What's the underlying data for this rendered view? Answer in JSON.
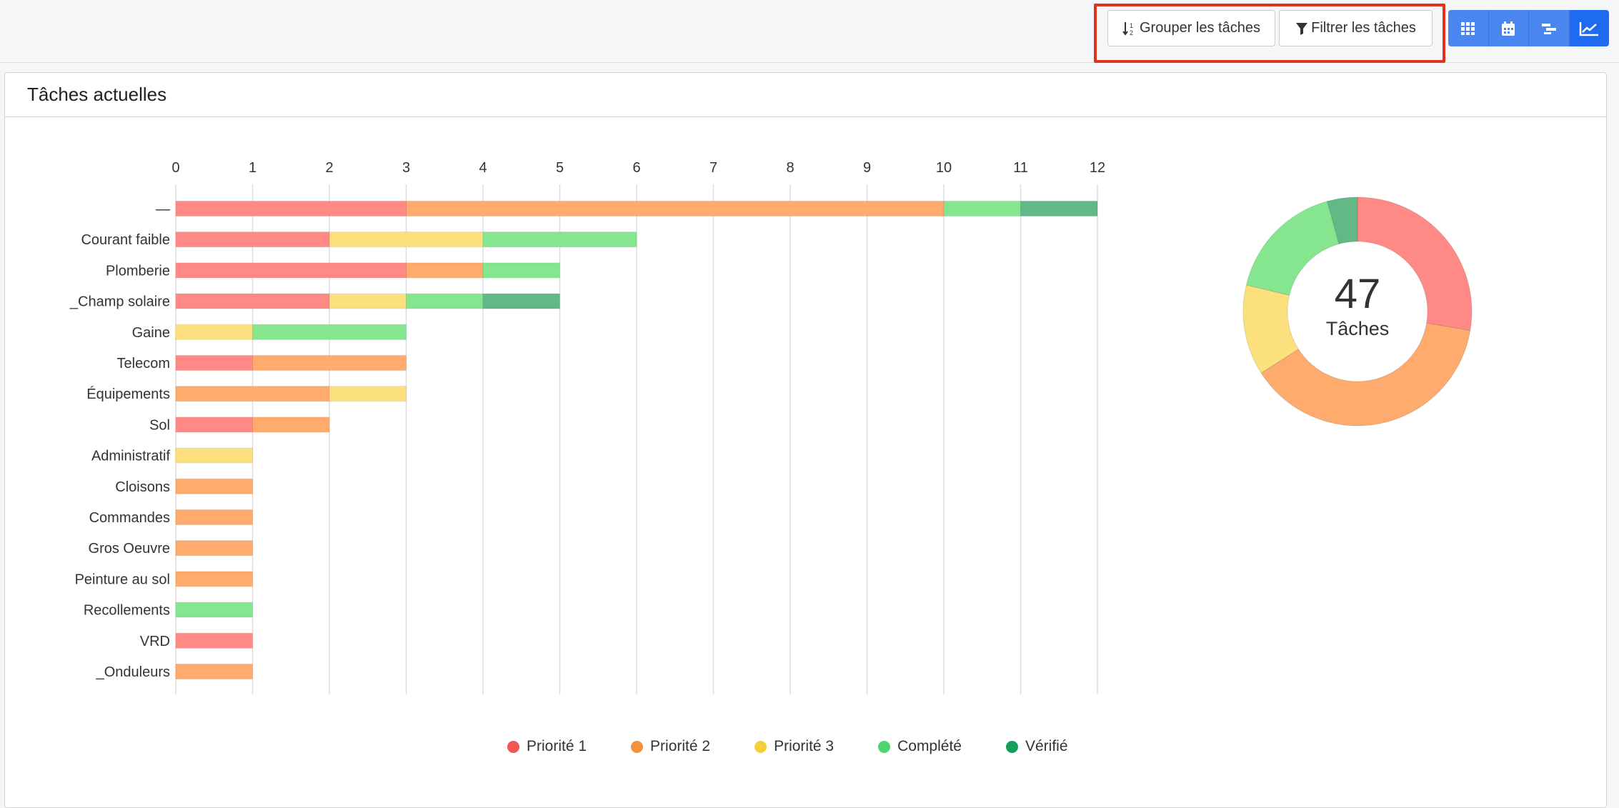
{
  "toolbar": {
    "group_label": "Grouper les tâches",
    "filter_label": "Filtrer les tâches",
    "views": [
      {
        "icon": "grid-icon",
        "active": false
      },
      {
        "icon": "calendar-icon",
        "active": false
      },
      {
        "icon": "gantt-icon",
        "active": false
      },
      {
        "icon": "chart-line-icon",
        "active": true
      }
    ]
  },
  "panel": {
    "title": "Tâches actuelles"
  },
  "colors": {
    "Priorité 1": "#ff8a85",
    "Priorité 2": "#ffab6e",
    "Priorité 3": "#fde07e",
    "Complété": "#86e690",
    "Vérifié": "#62b886"
  },
  "legend_dot_colors": {
    "Priorité 1": "#f25555",
    "Priorité 2": "#f5913c",
    "Priorité 3": "#f5cf3c",
    "Complété": "#4fd56a",
    "Vérifié": "#14a05a"
  },
  "chart_data": {
    "type": "bar",
    "orientation": "horizontal",
    "stacked": true,
    "xlim": [
      0,
      12
    ],
    "ticks": [
      0,
      1,
      2,
      3,
      4,
      5,
      6,
      7,
      8,
      9,
      10,
      11,
      12
    ],
    "grid": true,
    "legend_placement": "bottom",
    "categories": [
      "—",
      "Courant faible",
      "Plomberie",
      "_Champ solaire",
      "Gaine",
      "Telecom",
      "Équipements",
      "Sol",
      "Administratif",
      "Cloisons",
      "Commandes",
      "Gros Oeuvre",
      "Peinture au sol",
      "Recollements",
      "VRD",
      "_Onduleurs"
    ],
    "series": [
      {
        "name": "Priorité 1",
        "values": [
          3,
          2,
          3,
          2,
          0,
          1,
          0,
          1,
          0,
          0,
          0,
          0,
          0,
          0,
          1,
          0
        ]
      },
      {
        "name": "Priorité 2",
        "values": [
          7,
          0,
          1,
          0,
          0,
          2,
          2,
          1,
          0,
          1,
          1,
          1,
          1,
          0,
          0,
          1
        ]
      },
      {
        "name": "Priorité 3",
        "values": [
          0,
          2,
          0,
          1,
          1,
          0,
          1,
          0,
          1,
          0,
          0,
          0,
          0,
          0,
          0,
          0
        ]
      },
      {
        "name": "Complété",
        "values": [
          1,
          2,
          1,
          1,
          2,
          0,
          0,
          0,
          0,
          0,
          0,
          0,
          0,
          1,
          0,
          0
        ]
      },
      {
        "name": "Vérifié",
        "values": [
          1,
          0,
          0,
          1,
          0,
          0,
          0,
          0,
          0,
          0,
          0,
          0,
          0,
          0,
          0,
          0
        ]
      }
    ]
  },
  "donut": {
    "total": "47",
    "label": "Tâches",
    "slices": [
      {
        "name": "Priorité 1",
        "value": 13
      },
      {
        "name": "Priorité 2",
        "value": 18
      },
      {
        "name": "Priorité 3",
        "value": 6
      },
      {
        "name": "Complété",
        "value": 8
      },
      {
        "name": "Vérifié",
        "value": 2
      }
    ]
  }
}
